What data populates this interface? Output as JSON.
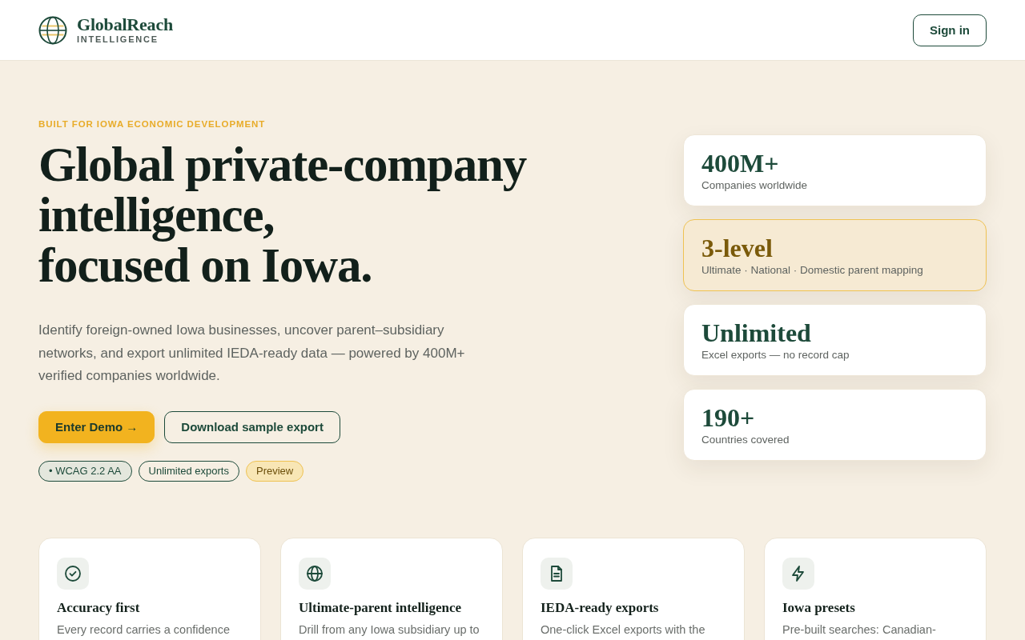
{
  "header": {
    "brand": {
      "name": "GlobalReach",
      "tagline": "INTELLIGENCE"
    },
    "sign_in_button": "Sign in"
  },
  "hero": {
    "eyebrow": "BUILT FOR IOWA ECONOMIC DEVELOPMENT",
    "headline_lines": [
      "Global private-company",
      "intelligence,",
      "focused on Iowa."
    ],
    "description": "Identify foreign-owned Iowa businesses, uncover parent–subsidiary networks, and export unlimited IEDA-ready data — powered by 400M+ verified companies worldwide.",
    "buttons": [
      {
        "label": "Enter Demo →",
        "kind": "primary"
      },
      {
        "label": "Download sample export",
        "kind": "secondary"
      }
    ],
    "tags": [
      {
        "label": "• WCAG 2.2 AA",
        "kind": "status"
      },
      {
        "label": "Unlimited exports",
        "kind": "outline"
      },
      {
        "label": "Preview",
        "kind": "accent"
      }
    ]
  },
  "stats": [
    {
      "value": "400M+",
      "label": "Companies worldwide",
      "highlighted": false
    },
    {
      "value": "3-level",
      "label": "Ultimate · National · Domestic parent mapping",
      "highlighted": true
    },
    {
      "value": "Unlimited",
      "label": "Excel exports — no record cap",
      "highlighted": false
    },
    {
      "value": "190+",
      "label": "Countries covered",
      "highlighted": false
    }
  ],
  "features": [
    {
      "title": "Accuracy first",
      "description": "Every record carries a confidence"
    },
    {
      "title": "Ultimate-parent intelligence",
      "description": "Drill from any Iowa subsidiary up to"
    },
    {
      "title": "IEDA-ready exports",
      "description": "One-click Excel exports with the"
    },
    {
      "title": "Iowa presets",
      "description": "Pre-built searches: Canadian-"
    }
  ]
}
